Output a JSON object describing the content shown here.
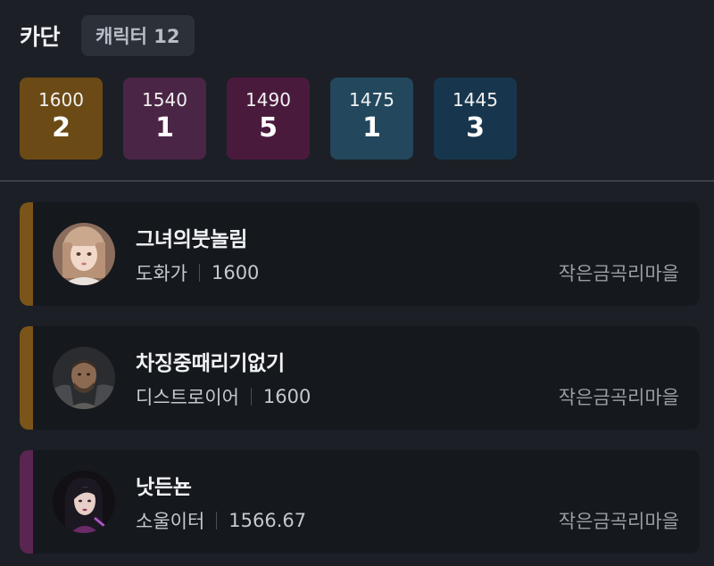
{
  "header": {
    "server_name": "카단",
    "char_count_label": "캐릭터 12"
  },
  "level_groups": [
    {
      "level": "1600",
      "count": "2",
      "color": "#6b4a16"
    },
    {
      "level": "1540",
      "count": "1",
      "color": "#4a2545"
    },
    {
      "level": "1490",
      "count": "5",
      "color": "#4a1a3c"
    },
    {
      "level": "1475",
      "count": "1",
      "color": "#23475c"
    },
    {
      "level": "1445",
      "count": "3",
      "color": "#17364d"
    }
  ],
  "characters": [
    {
      "name": "그녀의붓놀림",
      "class": "도화가",
      "item_level": "1600",
      "guild": "작은금곡리마을",
      "accent_color": "#7a5418",
      "avatar_icon": "female-artist-portrait"
    },
    {
      "name": "차징중때리기없기",
      "class": "디스트로이어",
      "item_level": "1600",
      "guild": "작은금곡리마을",
      "accent_color": "#7a5418",
      "avatar_icon": "male-warrior-portrait"
    },
    {
      "name": "낫든뇬",
      "class": "소울이터",
      "item_level": "1566.67",
      "guild": "작은금곡리마을",
      "accent_color": "#5a2550",
      "avatar_icon": "female-souleater-portrait"
    }
  ]
}
